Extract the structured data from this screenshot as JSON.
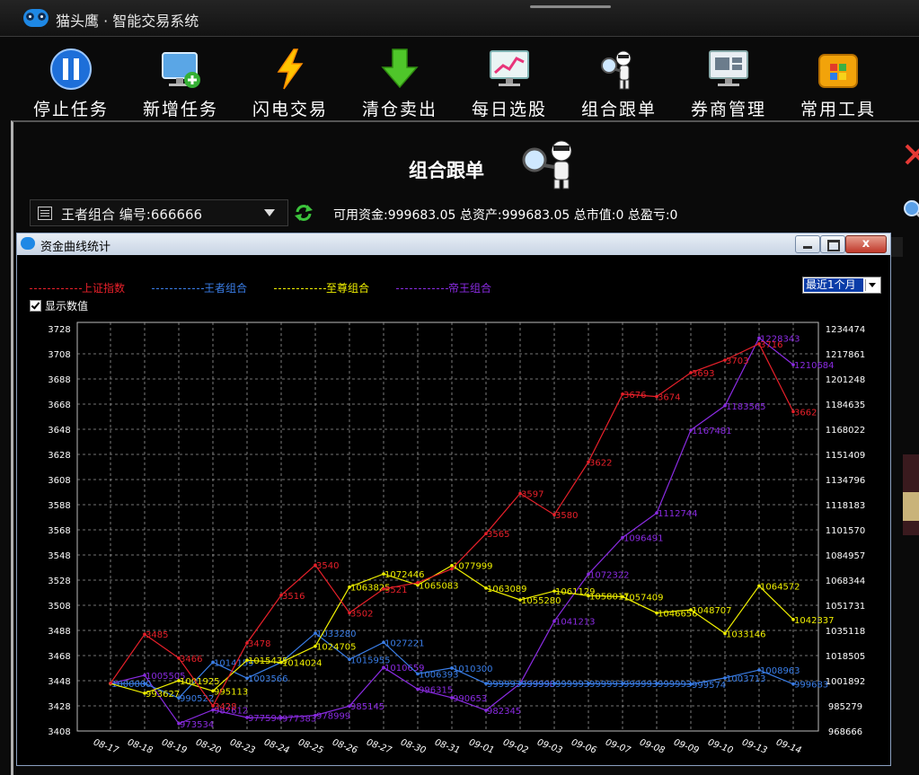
{
  "app": {
    "title": "猫头鹰 · 智能交易系统"
  },
  "toolbar": {
    "items": [
      {
        "label": "停止任务",
        "icon": "pause-icon"
      },
      {
        "label": "新增任务",
        "icon": "add-task-icon"
      },
      {
        "label": "闪电交易",
        "icon": "lightning-icon"
      },
      {
        "label": "清仓卖出",
        "icon": "download-arrow-icon"
      },
      {
        "label": "每日选股",
        "icon": "stock-chart-icon"
      },
      {
        "label": "组合跟单",
        "icon": "magnifier-person-icon"
      },
      {
        "label": "券商管理",
        "icon": "monitor-icon"
      },
      {
        "label": "常用工具",
        "icon": "toolbox-icon"
      }
    ]
  },
  "panel": {
    "title": "组合跟单",
    "portfolio_select": "王者组合  编号:666666",
    "fund_info": "可用资金:999683.05 总资产:999683.05 总市值:0 总盈亏:0"
  },
  "dialog": {
    "title": "资金曲线统计",
    "close_label": "x",
    "range": "最近1个月",
    "show_values_label": "显示数值"
  },
  "colors": {
    "red": "#e8202a",
    "blue": "#3a7ee8",
    "yellow": "#f0f000",
    "purple": "#8a2be2",
    "grid": "#9a9a9a"
  },
  "chart_data": {
    "type": "line",
    "categories": [
      "08-17",
      "08-18",
      "08-19",
      "08-20",
      "08-23",
      "08-24",
      "08-25",
      "08-26",
      "08-27",
      "08-30",
      "08-31",
      "09-01",
      "09-02",
      "09-03",
      "09-06",
      "09-07",
      "09-08",
      "09-09",
      "09-10",
      "09-13",
      "09-14"
    ],
    "left_axis": {
      "ticks": [
        3728,
        3708,
        3688,
        3668,
        3648,
        3628,
        3608,
        3588,
        3568,
        3548,
        3528,
        3508,
        3488,
        3468,
        3448,
        3428,
        3408
      ],
      "range": [
        3408,
        3728
      ]
    },
    "right_axis": {
      "ticks": [
        1234474,
        1217861,
        1201248,
        1184635,
        1168022,
        1151409,
        1134796,
        1118183,
        1101570,
        1084957,
        1068344,
        1051731,
        1035118,
        1018505,
        1001892,
        985279,
        968666
      ],
      "range": [
        968666,
        1234474
      ]
    },
    "series": [
      {
        "name": "上证指数",
        "axis": "left",
        "color": "#e8202a",
        "values": [
          3446,
          3485,
          3466,
          3428,
          3478,
          3516,
          3540,
          3502,
          3521,
          3526,
          3537,
          3565,
          3597,
          3580,
          3622,
          3676,
          3674,
          3693,
          3703,
          3716,
          3662
        ],
        "labels": [
          "",
          "3485",
          "3466",
          "3428",
          "3478",
          "3516",
          "3540",
          "3502",
          "3521",
          "",
          "",
          "3565",
          "3597",
          "3580",
          "3622",
          "3676",
          "3674",
          "3693",
          "3703",
          "3716",
          "3662"
        ]
      },
      {
        "name": "王者组合",
        "axis": "right",
        "color": "#3a7ee8",
        "values": [
          1000000,
          1000000,
          990522,
          1014159,
          1003566,
          1014024,
          1033280,
          1015955,
          1027221,
          1006393,
          1010300,
          999993,
          999993,
          999993,
          999993,
          999993,
          999993,
          999574,
          1003713,
          1008963,
          999683
        ],
        "labels": [
          "1000000",
          "",
          "990522",
          "1014159",
          "1003566",
          "",
          "1033280",
          "1015955",
          "1027221",
          "1006393",
          "1010300",
          "999993",
          "999993",
          "999993",
          "999993",
          "999993",
          "999993",
          "999574",
          "1003713",
          "1008963",
          "999683"
        ]
      },
      {
        "name": "至尊组合",
        "axis": "right",
        "color": "#f0f000",
        "values": [
          1000000,
          993627,
          1001925,
          995113,
          1015435,
          1014024,
          1024705,
          1063825,
          1072446,
          1065083,
          1077999,
          1063089,
          1055280,
          1061129,
          1058017,
          1057409,
          1046656,
          1048707,
          1033146,
          1064572,
          1042337
        ],
        "labels": [
          "",
          "993627",
          "1001925",
          "995113",
          "1015435",
          "1014024",
          "1024705",
          "1063825",
          "1072446",
          "1065083",
          "1077999",
          "1063089",
          "1055280",
          "1061129",
          "1058017",
          "1057409",
          "1046656",
          "1048707",
          "1033146",
          "1064572",
          "1042337"
        ]
      },
      {
        "name": "帝王组合",
        "axis": "right",
        "color": "#8a2be2",
        "values": [
          1000000,
          1005505,
          973534,
          982612,
          977594,
          977383,
          978999,
          985145,
          1010659,
          996315,
          990653,
          982345,
          999998,
          1041213,
          1072322,
          1096491,
          1112744,
          1167481,
          1183565,
          1228343,
          1210684
        ],
        "labels": [
          "",
          "1005505",
          "973534",
          "982612",
          "977594",
          "977383",
          "978999",
          "985145",
          "1010659",
          "996315",
          "990653",
          "982345",
          "999998",
          "1041213",
          "1072322",
          "1096491",
          "1112744",
          "1167481",
          "1183565",
          "1228343",
          "1210684"
        ]
      }
    ]
  }
}
